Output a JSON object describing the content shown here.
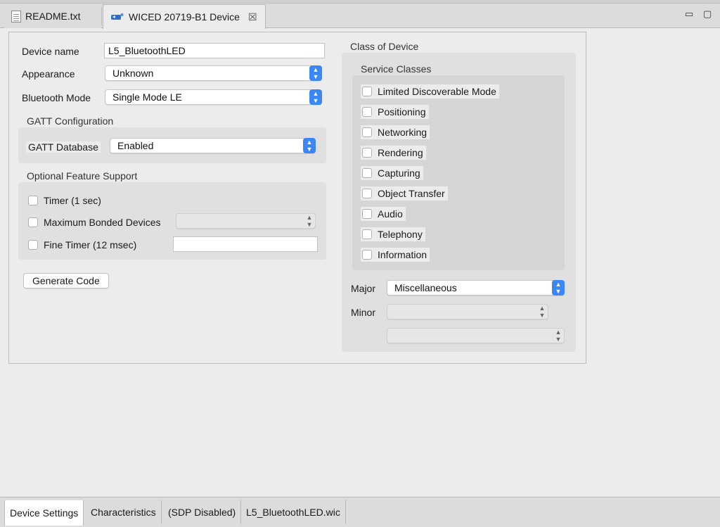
{
  "tabs": {
    "readme": "README.txt",
    "device": "WICED 20719-B1 Device",
    "close_glyph": "☒"
  },
  "window_controls": {
    "minimize": "▭",
    "maximize": "▢"
  },
  "device": {
    "name_label": "Device name",
    "name_value": "L5_BluetoothLED",
    "appearance_label": "Appearance",
    "appearance_value": "Unknown",
    "mode_label": "Bluetooth Mode",
    "mode_value": "Single Mode LE"
  },
  "gatt": {
    "group_label": "GATT Configuration",
    "db_label": "GATT Database",
    "db_value": "Enabled"
  },
  "optional": {
    "group_label": "Optional Feature Support",
    "timer_label": "Timer (1 sec)",
    "bonded_label": "Maximum Bonded Devices",
    "fine_timer_label": "Fine Timer (12 msec)"
  },
  "generate_button": "Generate Code",
  "class_of_device": {
    "group_label": "Class of Device",
    "service_classes_label": "Service Classes",
    "service_classes": [
      "Limited Discoverable Mode",
      "Positioning",
      "Networking",
      "Rendering",
      "Capturing",
      "Object Transfer",
      "Audio",
      "Telephony",
      "Information"
    ],
    "major_label": "Major",
    "major_value": "Miscellaneous",
    "minor_label": "Minor"
  },
  "bottom_tabs": [
    "Device Settings",
    "Characteristics",
    "(SDP Disabled)",
    "L5_BluetoothLED.wic"
  ],
  "colors": {
    "accent": "#3a87f5"
  }
}
